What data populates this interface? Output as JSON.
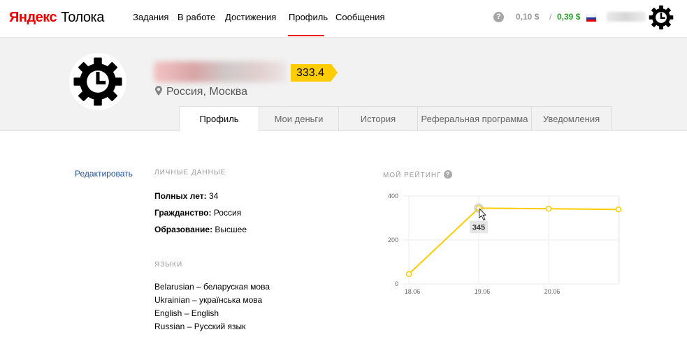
{
  "brand": {
    "ya": "Яндекс",
    "tol": "Толока"
  },
  "nav": {
    "items": [
      "Задания",
      "В работе",
      "Достижения",
      "Профиль",
      "Сообщения"
    ],
    "active": "Профиль"
  },
  "balance": {
    "help": "?",
    "pending": "0,10 $",
    "separator": "/",
    "available": "0,39 $"
  },
  "profile": {
    "score": "333.4",
    "location": "Россия, Москва"
  },
  "tabs": [
    "Профиль",
    "Мои деньги",
    "История",
    "Реферальная программа",
    "Уведомления"
  ],
  "active_tab": "Профиль",
  "edit_label": "Редактировать",
  "personal": {
    "title": "ЛИЧНЫЕ ДАННЫЕ",
    "age_label": "Полных лет:",
    "age_value": " 34",
    "citizenship_label": "Гражданство:",
    "citizenship_value": " Россия",
    "education_label": "Образование:",
    "education_value": " Высшее"
  },
  "languages": {
    "title": "ЯЗЫКИ",
    "items": [
      "Belarusian – беларуская мова",
      "Ukrainian – українська мова",
      "English – English",
      "Russian – Русский язык"
    ]
  },
  "rating": {
    "title": "МОЙ РЕЙТИНГ",
    "help": "?"
  },
  "colors": {
    "accent": "#ffcc00",
    "link": "#1e4f9c",
    "brand_red": "#ee0000",
    "money_green": "#2d9e2d"
  },
  "chart_data": {
    "type": "line",
    "x": [
      "18.06",
      "19.06",
      "20.06",
      "21.06"
    ],
    "x_tick_labels": [
      "18.06",
      "19.06",
      "20.06"
    ],
    "values": [
      45,
      345,
      342,
      339
    ],
    "ylim": [
      0,
      400
    ],
    "y_ticks": [
      0,
      200,
      400
    ],
    "tooltip": {
      "x": "19.06",
      "label": "345"
    },
    "grid": true,
    "color": "#ffcc00"
  }
}
